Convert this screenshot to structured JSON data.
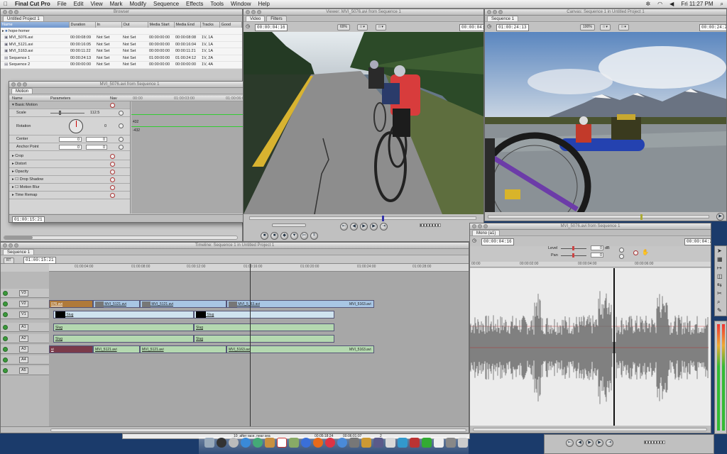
{
  "menubar": {
    "app": "Final Cut Pro",
    "items": [
      "File",
      "Edit",
      "View",
      "Mark",
      "Modify",
      "Sequence",
      "Effects",
      "Tools",
      "Window",
      "Help"
    ],
    "clock": "Fri 11:27 PM"
  },
  "browser": {
    "title": "Browser",
    "tab": "Untitled Project 1",
    "columns": [
      "Name",
      "Duration",
      "In",
      "Out",
      "Media Start",
      "Media End",
      "Tracks",
      "Good"
    ],
    "rows": [
      {
        "name": "hope-homer",
        "duration": "",
        "in": "",
        "out": "",
        "start": "",
        "end": "",
        "tracks": ""
      },
      {
        "name": "MVI_5076.avi",
        "duration": "00:00:08:09",
        "in": "Not Set",
        "out": "Not Set",
        "start": "00:00:00:00",
        "end": "00:00:08:08",
        "tracks": "1V, 1A"
      },
      {
        "name": "MVI_5121.avi",
        "duration": "00:00:16:05",
        "in": "Not Set",
        "out": "Not Set",
        "start": "00:00:00:00",
        "end": "00:00:16:04",
        "tracks": "1V, 1A"
      },
      {
        "name": "MVI_5163.avi",
        "duration": "00:00:11:22",
        "in": "Not Set",
        "out": "Not Set",
        "start": "00:00:00:00",
        "end": "00:00:11:21",
        "tracks": "1V, 1A"
      },
      {
        "name": "Sequence 1",
        "duration": "00:00:24:13",
        "in": "Not Set",
        "out": "Not Set",
        "start": "01:00:00:00",
        "end": "01:00:24:12",
        "tracks": "1V, 2A"
      },
      {
        "name": "Sequence 2",
        "duration": "00:00:00:00",
        "in": "Not Set",
        "out": "Not Set",
        "start": "00:00:00:00",
        "end": "00:00:00:00",
        "tracks": "1V, 4A"
      }
    ]
  },
  "motion": {
    "title": "MVI_5076.avi from Sequence 1",
    "tab": "Motion",
    "headers": {
      "name": "Name",
      "params": "Parameters",
      "nav": "Nav"
    },
    "ruler": [
      "00:00",
      "01:00:03:00",
      "01:00:06:00"
    ],
    "rows": [
      {
        "label": "Basic Motion",
        "v1": "",
        "v2": ""
      },
      {
        "label": "Scale",
        "v1": "112.5",
        "v2": ""
      },
      {
        "label": "Rotation",
        "v1": "0",
        "v2": ""
      },
      {
        "label": "Center",
        "v1": "0",
        "v2": "0"
      },
      {
        "label": "Anchor Point",
        "v1": "0",
        "v2": "0"
      },
      {
        "label": "Crop",
        "v1": "",
        "v2": ""
      },
      {
        "label": "Distort",
        "v1": "",
        "v2": ""
      },
      {
        "label": "Opacity",
        "v1": "",
        "v2": ""
      },
      {
        "label": "Drop Shadow",
        "v1": "",
        "v2": ""
      },
      {
        "label": "Motion Blur",
        "v1": "",
        "v2": ""
      },
      {
        "label": "Time Remap",
        "v1": "",
        "v2": ""
      }
    ],
    "rot_max": "432",
    "rot_min": "-432",
    "timecode": "01:00:15:21"
  },
  "viewer": {
    "title": "Viewer: MVI_5076.avi from Sequence 1",
    "tabs": [
      "Video",
      "Filters"
    ],
    "tc_left": "00:00:04:16",
    "zoom": "69%",
    "tc_right": "00:00:04:28"
  },
  "canvas": {
    "title": "Canvas: Sequence 1 in Untitled Project 1",
    "tab": "Sequence 1",
    "tc_left": "01:00:24:13",
    "zoom": "100%",
    "tc_right": "00:00:24:28"
  },
  "audio": {
    "title": "MVI_5076.avi from Sequence 1",
    "tab": "Mono (a1)",
    "tc_left": "00:00:04:16",
    "tc_right": "00:00:04:28",
    "level_label": "Level",
    "level_value": "0",
    "level_unit": "dB",
    "pan_label": "Pan",
    "pan_value": "0",
    "ruler": [
      "00:00",
      "00:00:02:00",
      "00:00:04:00",
      "00:00:06:00"
    ]
  },
  "timeline": {
    "title": "Timeline: Sequence 1 in Untitled Project 1",
    "tab": "Sequence 1",
    "rt": "RT",
    "tc": "01:00:15:21",
    "ruler": [
      "01:00:04:00",
      "01:00:08:00",
      "01:00:12:00",
      "01:00:16:00",
      "01:00:20:00",
      "01:00:24:00",
      "01:00:28:00"
    ],
    "tracks": [
      "V3",
      "V2",
      "V1",
      "A1",
      "A2",
      "A3",
      "A4",
      "A5"
    ],
    "v2clips": [
      "076.avi",
      "MVI_5121.avi",
      "MVI_5121.avi",
      "MVI_5_63.avi",
      "MVI_5163.avi"
    ],
    "slug": "Slug",
    "a3clips": [
      "vi",
      "MVI_5121.avi",
      "MVI_5121.avi",
      "MVI_5163.avi",
      "MVI_5163.avi"
    ]
  },
  "taskbar": {
    "text1": "10_after race, near sea",
    "tc1": "00:05:18:24",
    "tc2": "00:06:01:07",
    "num": "2"
  }
}
